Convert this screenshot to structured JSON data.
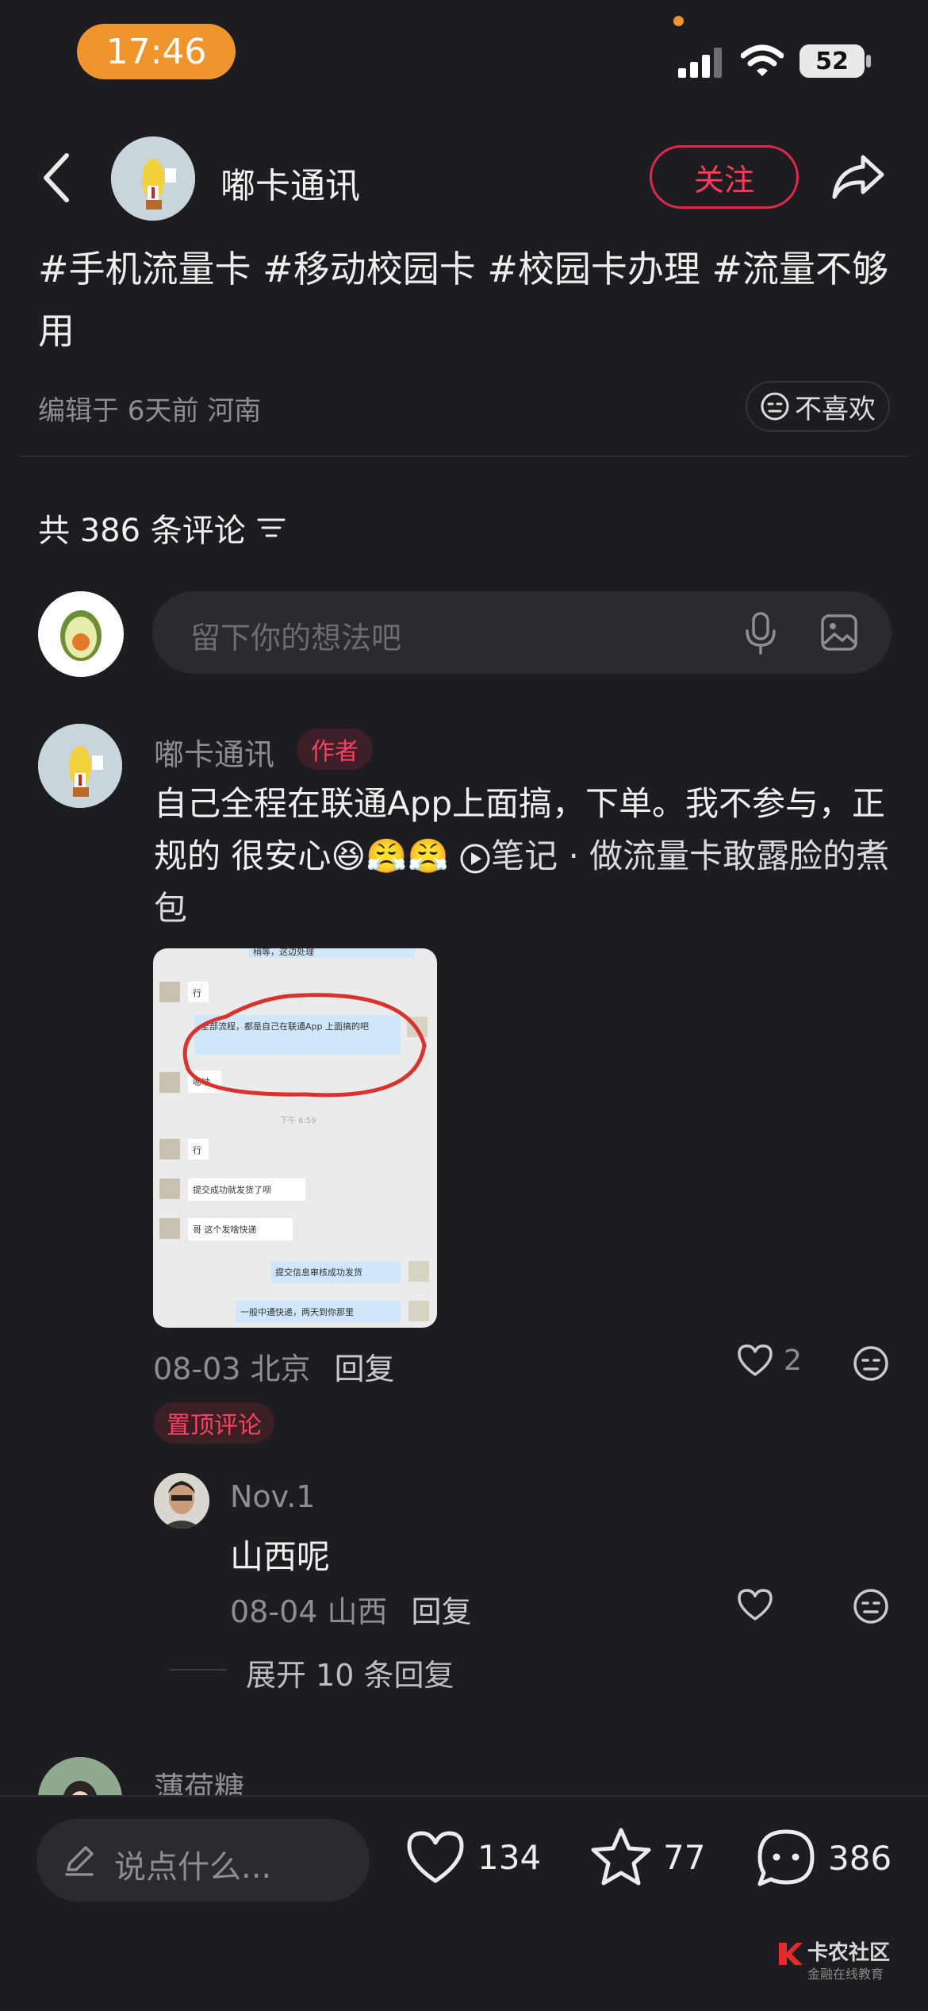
{
  "status_bar": {
    "time": "17:46",
    "battery": "52"
  },
  "header": {
    "author_name": "嘟卡通讯",
    "follow_label": "关注"
  },
  "post": {
    "tags": "#手机流量卡 #移动校园卡 #校园卡办理 #流量不够用",
    "meta": "编辑于 6天前 河南",
    "dislike_label": "不喜欢"
  },
  "comments_section": {
    "count_label": "共 386 条评论",
    "input_placeholder": "留下你的想法吧"
  },
  "comment1": {
    "name": "嘟卡通讯",
    "badge": "作者",
    "text_main": "自己全程在联通App上面搞，下单。我不参与，正规的 很安心",
    "emojis": "😆😤😤",
    "note_link": "笔记 · 做流量卡敢露脸的煮包",
    "date_location": "08-03 北京",
    "reply_label": "回复",
    "likes": "2",
    "pinned_label": "置顶评论",
    "screenshot_texts": {
      "top": "稍等，这边处理",
      "r1": "行",
      "b1": "全部流程，都是自己在联通App 上面搞的吧",
      "r2": "嗯呐",
      "time": "下午 6:59",
      "r3": "行",
      "r4": "提交成功就发货了呗",
      "r5": "哥 这个发啥快递",
      "b2": "提交信息审核成功发货",
      "b3": "一般中通快递，两天到你那里"
    }
  },
  "reply1": {
    "name": "Nov.1",
    "text": "山西呢",
    "date_location": "08-04 山西",
    "reply_label": "回复",
    "expand_label": "展开 10 条回复"
  },
  "comment2": {
    "name": "薄荷糖"
  },
  "bottom_bar": {
    "say_placeholder": "说点什么...",
    "likes": "134",
    "favorites": "77",
    "comments": "386"
  },
  "watermark": {
    "title": "卡农社区",
    "subtitle": "金融在线教育"
  }
}
